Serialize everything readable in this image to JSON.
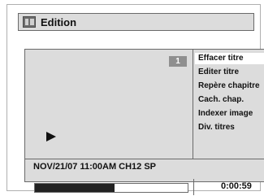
{
  "window": {
    "title": "Edition",
    "title_icon": "title-edit-icon"
  },
  "preview": {
    "page_number": "1",
    "play_icon": "play-icon"
  },
  "menu": {
    "items": [
      {
        "label": "Effacer titre",
        "selected": true
      },
      {
        "label": "Editer titre",
        "selected": false
      },
      {
        "label": "Repère chapitre",
        "selected": false
      },
      {
        "label": "Cach. chap.",
        "selected": false
      },
      {
        "label": "Indexer image",
        "selected": false
      },
      {
        "label": "Div. titres",
        "selected": false
      }
    ]
  },
  "status": {
    "text": "NOV/21/07 11:00AM CH12 SP"
  },
  "playback": {
    "progress_fraction": 0.52,
    "time": "0:00:59"
  },
  "colors": {
    "panel_bg": "#dcdcdc",
    "selected_bg": "#ffffff",
    "progress_fill": "#222222"
  }
}
